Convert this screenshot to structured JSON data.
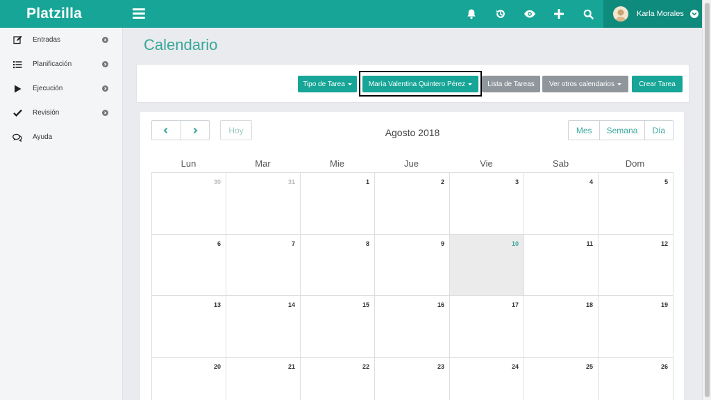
{
  "app": {
    "name": "Platzilla"
  },
  "user": {
    "name": "Karla Morales"
  },
  "sidebar": {
    "items": [
      {
        "label": "Entradas",
        "icon": "edit-icon"
      },
      {
        "label": "Planificación",
        "icon": "list-icon"
      },
      {
        "label": "Ejecución",
        "icon": "play-icon"
      },
      {
        "label": "Revisión",
        "icon": "check-icon"
      },
      {
        "label": "Ayuda",
        "icon": "chat-icon"
      }
    ]
  },
  "page": {
    "title": "Calendario"
  },
  "toolbar": {
    "tipo_tarea": "Tipo de Tarea",
    "persona": "María Valentina Quintero Pérez",
    "lista_tareas": "Lista de Tareas",
    "otros_calendarios": "Ver otros calendarios",
    "crear_tarea": "Crear Tarea"
  },
  "calendar": {
    "today_label": "Hoy",
    "title": "Agosto 2018",
    "views": [
      "Mes",
      "Semana",
      "Día"
    ],
    "weekdays": [
      "Lun",
      "Mar",
      "Mie",
      "Jue",
      "Vie",
      "Sab",
      "Dom"
    ],
    "weeks": [
      [
        "30",
        "31",
        "1",
        "2",
        "3",
        "4",
        "5"
      ],
      [
        "6",
        "7",
        "8",
        "9",
        "10",
        "11",
        "12"
      ],
      [
        "13",
        "14",
        "15",
        "16",
        "17",
        "18",
        "19"
      ],
      [
        "20",
        "21",
        "22",
        "23",
        "24",
        "25",
        "26"
      ]
    ],
    "today": "10"
  },
  "colors": {
    "brand": "#16a596",
    "brand_dark": "#0f8b7e",
    "gray_button": "#8f979c"
  }
}
